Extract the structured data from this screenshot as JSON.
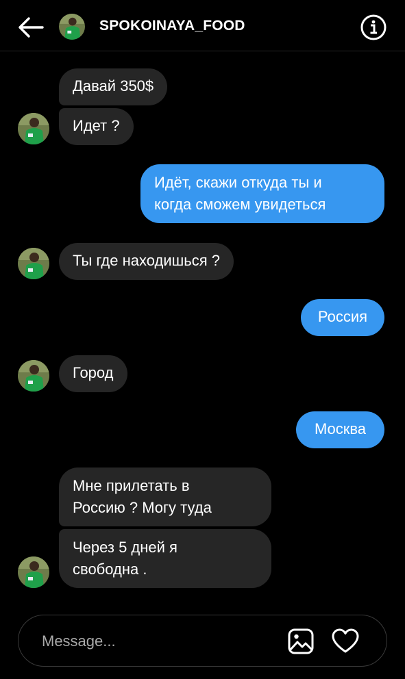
{
  "header": {
    "username": "SPOKOINAYA_FOOD",
    "back_icon": "arrow-left-icon",
    "info_icon": "info-circle-icon"
  },
  "messages": [
    {
      "from": "them",
      "text": "Давай 350$"
    },
    {
      "from": "them",
      "text": "Идет ?"
    },
    {
      "from": "me",
      "text": "Идёт, скажи откуда ты и\nкогда сможем увидеться"
    },
    {
      "from": "them",
      "text": "Ты где находишься ?"
    },
    {
      "from": "me",
      "text": "Россия"
    },
    {
      "from": "them",
      "text": "Город"
    },
    {
      "from": "me",
      "text": "Москва"
    },
    {
      "from": "them",
      "text": "Мне прилетать в\nРоссию ? Могу туда"
    },
    {
      "from": "them",
      "text": "Через 5 дней я\nсвободна ."
    }
  ],
  "composer": {
    "placeholder": "Message...",
    "gallery_icon": "image-icon",
    "like_icon": "heart-icon"
  },
  "colors": {
    "background": "#000000",
    "incoming_bubble": "#262626",
    "outgoing_bubble": "#3797f0"
  }
}
